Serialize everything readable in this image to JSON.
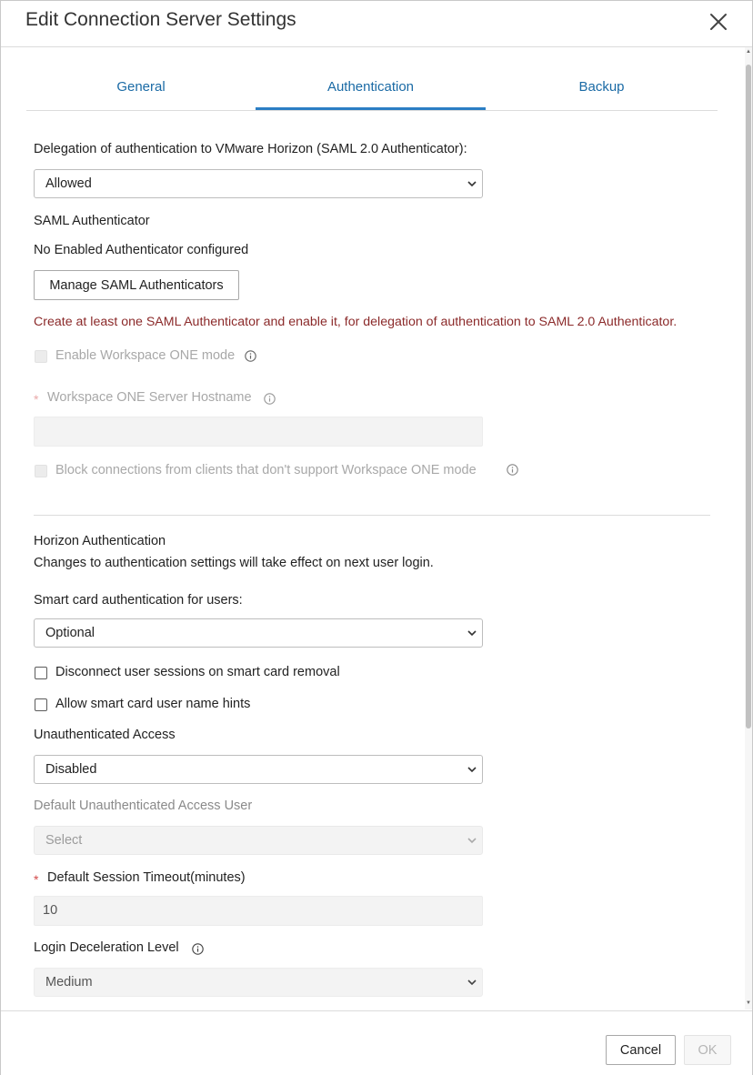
{
  "dialog": {
    "title": "Edit Connection Server Settings"
  },
  "tabs": [
    {
      "label": "General",
      "active": false
    },
    {
      "label": "Authentication",
      "active": true
    },
    {
      "label": "Backup",
      "active": false
    }
  ],
  "saml": {
    "delegation_label": "Delegation of authentication to VMware Horizon (SAML 2.0 Authenticator):",
    "delegation_value": "Allowed",
    "authenticator_heading": "SAML Authenticator",
    "authenticator_status": "No Enabled Authenticator configured",
    "manage_button": "Manage SAML Authenticators",
    "error_text": "Create at least one SAML Authenticator and enable it, for delegation of authentication to SAML 2.0 Authenticator.",
    "enable_ws1_label": "Enable Workspace ONE mode",
    "ws1_hostname_label": "Workspace ONE Server Hostname",
    "ws1_hostname_value": "",
    "block_label": "Block connections from clients that don't support Workspace ONE mode"
  },
  "horizon": {
    "heading": "Horizon Authentication",
    "note": "Changes to authentication settings will take effect on next user login.",
    "smart_card_label": "Smart card authentication for users:",
    "smart_card_value": "Optional",
    "disconnect_label": "Disconnect user sessions on smart card removal",
    "hints_label": "Allow smart card user name hints",
    "unauth_label": "Unauthenticated Access",
    "unauth_value": "Disabled",
    "default_user_label": "Default Unauthenticated Access User",
    "default_user_value": "Select",
    "timeout_label": "Default Session Timeout(minutes)",
    "timeout_value": "10",
    "deceleration_label": "Login Deceleration Level",
    "deceleration_value": "Medium"
  },
  "footer": {
    "cancel": "Cancel",
    "ok": "OK"
  },
  "required_marker": "*",
  "colors": {
    "accent": "#2b7ec4",
    "tab_text": "#1a6aa5",
    "error": "#8b2a2a",
    "required": "#d24a4a"
  }
}
